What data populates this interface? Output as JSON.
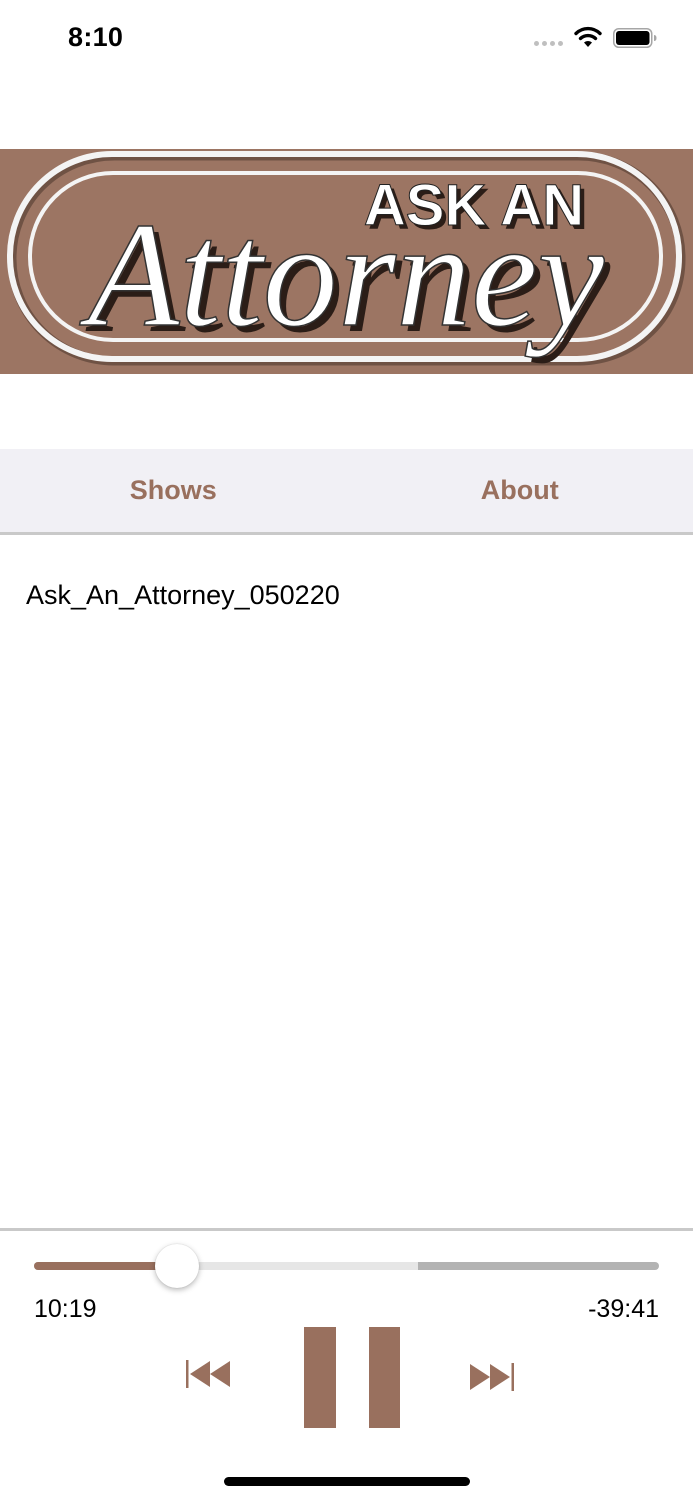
{
  "status_bar": {
    "time": "8:10"
  },
  "banner": {
    "line1": "ASK AN",
    "line2": "Attorney",
    "colors": {
      "background": "#9c7563",
      "lettering": "#ffffff"
    }
  },
  "tabs": [
    {
      "label": "Shows"
    },
    {
      "label": "About"
    }
  ],
  "episodes": [
    {
      "title": "Ask_An_Attorney_050220"
    }
  ],
  "player": {
    "elapsed": "10:19",
    "remaining": "-39:41",
    "progress_fraction": 0.228,
    "buffered_fraction": 0.615,
    "state": "playing"
  },
  "theme": {
    "accent": "#99705e",
    "tab_bar_background": "#f1f0f5"
  },
  "icons": [
    "wifi-icon",
    "battery-icon",
    "signal-icon",
    "previous-track-icon",
    "pause-icon",
    "next-track-icon"
  ]
}
